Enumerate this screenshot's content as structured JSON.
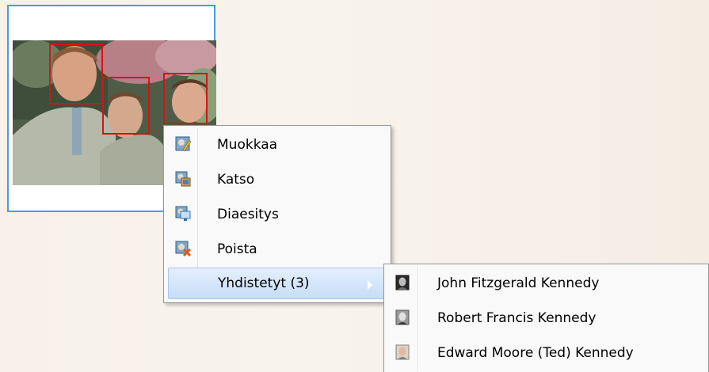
{
  "context_menu": {
    "items": [
      {
        "label": "Muokkaa",
        "icon": "edit-icon"
      },
      {
        "label": "Katso",
        "icon": "view-icon"
      },
      {
        "label": "Diaesitys",
        "icon": "slideshow-icon"
      },
      {
        "label": "Poista",
        "icon": "delete-icon"
      },
      {
        "label": "Yhdistetyt (3)",
        "icon": "",
        "has_submenu": true
      }
    ]
  },
  "submenu": {
    "items": [
      {
        "label": "John Fitzgerald Kennedy",
        "icon": "person-thumbnail-icon"
      },
      {
        "label": "Robert Francis Kennedy",
        "icon": "person-thumbnail-icon"
      },
      {
        "label": "Edward Moore (Ted) Kennedy",
        "icon": "person-thumbnail-icon"
      }
    ]
  },
  "colors": {
    "selection_border": "#4a98e8",
    "face_box": "#d41414",
    "menu_highlight": "#c7ddf8"
  }
}
